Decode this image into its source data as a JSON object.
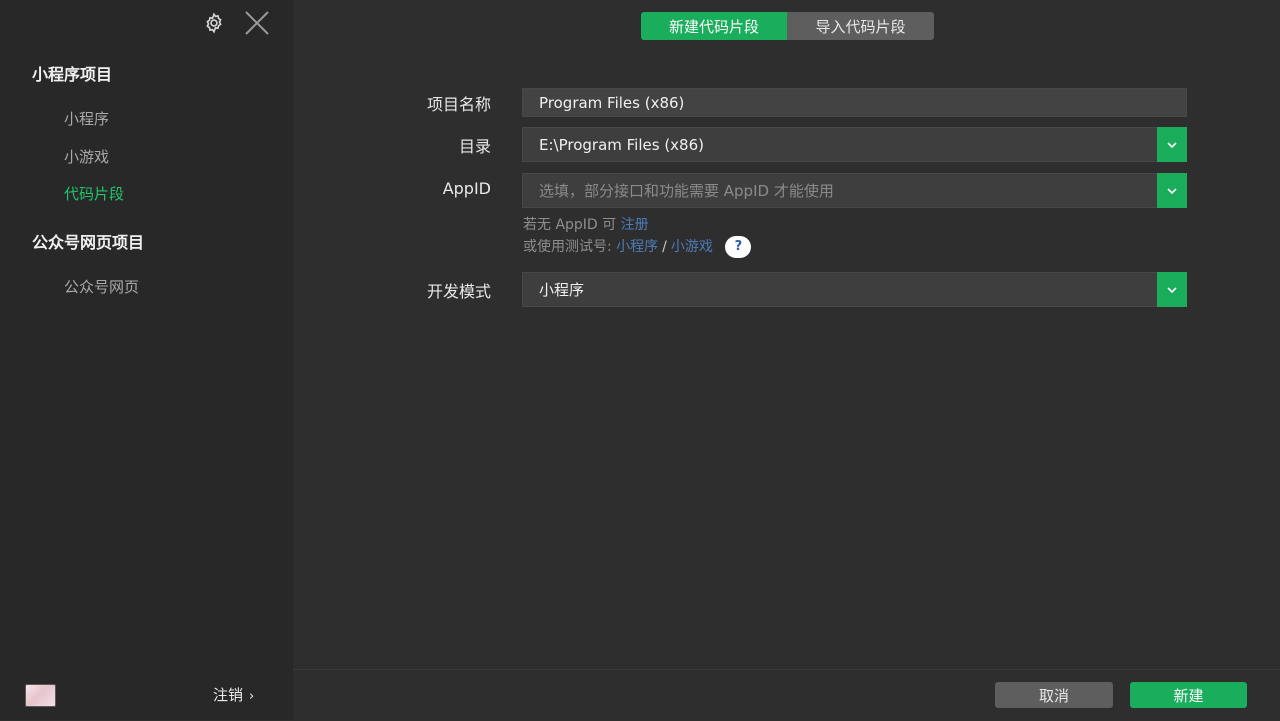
{
  "sidebar": {
    "groups": [
      {
        "title": "小程序项目",
        "items": [
          {
            "label": "小程序",
            "active": false
          },
          {
            "label": "小游戏",
            "active": false
          },
          {
            "label": "代码片段",
            "active": true
          }
        ]
      },
      {
        "title": "公众号网页项目",
        "items": [
          {
            "label": "公众号网页",
            "active": false
          }
        ]
      }
    ],
    "logout_label": "注销",
    "logout_chevron": "›"
  },
  "tabs": {
    "new_snippet": "新建代码片段",
    "import_snippet": "导入代码片段"
  },
  "form": {
    "project_name": {
      "label": "项目名称",
      "value": "Program Files (x86)"
    },
    "directory": {
      "label": "目录",
      "value": "E:\\Program Files (x86)"
    },
    "appid": {
      "label": "AppID",
      "placeholder": "选填，部分接口和功能需要 AppID 才能使用",
      "hint_prefix": "若无 AppID 可",
      "hint_register": "注册",
      "hint_test_prefix": "或使用测试号:",
      "hint_test_miniprogram": "小程序",
      "hint_sep": "/",
      "hint_test_minigame": "小游戏",
      "help_icon": "?"
    },
    "dev_mode": {
      "label": "开发模式",
      "value": "小程序"
    }
  },
  "footer": {
    "cancel_label": "取消",
    "create_label": "新建"
  },
  "colors": {
    "accent": "#1aad5b",
    "active_nav": "#20c56d",
    "link": "#4d7bb8"
  },
  "icons": [
    "gear-icon",
    "close-icon",
    "chevron-down-icon",
    "help-icon",
    "avatar"
  ]
}
